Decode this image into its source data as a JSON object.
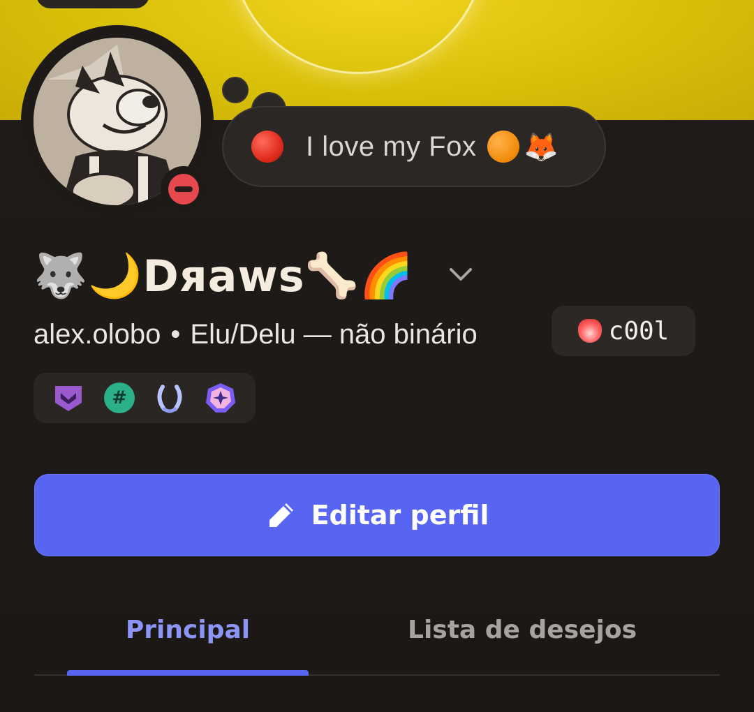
{
  "profile": {
    "status_text": "I love my Fox",
    "status_emoji_end": "🦊",
    "display_name_prefix": "🐺🌙",
    "display_name": "Dяaws",
    "display_name_suffix": "🦴🌈",
    "username": "alex.olobo",
    "separator": "•",
    "pronouns": "Elu/Delu — não binário",
    "clan_tag": "c00l",
    "badges": [
      "hypesquad-icon",
      "hashtag-icon",
      "laurel-icon",
      "gem-icon"
    ],
    "status": "do-not-disturb"
  },
  "actions": {
    "edit_profile_label": "Editar perfil"
  },
  "tabs": [
    {
      "label": "Principal",
      "active": true
    },
    {
      "label": "Lista de desejos",
      "active": false
    }
  ],
  "colors": {
    "accent": "#5865f2",
    "banner": "#d8c009",
    "background": "#1c1817",
    "dnd": "#e5484d"
  }
}
